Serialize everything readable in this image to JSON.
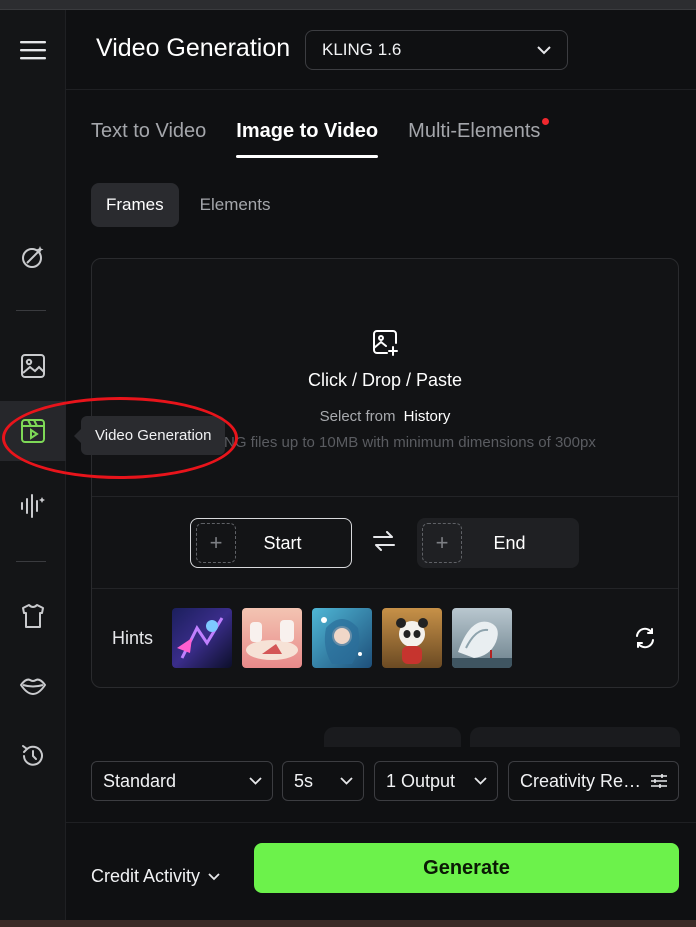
{
  "header": {
    "title": "Video Generation",
    "model": "KLING 1.6"
  },
  "tabs": [
    {
      "label": "Text to Video",
      "active": false
    },
    {
      "label": "Image to Video",
      "active": true
    },
    {
      "label": "Multi-Elements",
      "active": false,
      "has_dot": true
    }
  ],
  "subtabs": [
    {
      "label": "Frames",
      "active": true
    },
    {
      "label": "Elements",
      "active": false
    }
  ],
  "upload": {
    "title": "Click / Drop / Paste",
    "select_from": "Select from",
    "history": "History",
    "file_hint": "NG files up to 10MB with minimum dimensions of 300px"
  },
  "frames": {
    "start": "Start",
    "end": "End"
  },
  "hints": {
    "label": "Hints",
    "thumbnails": [
      "hint-thumb-1",
      "hint-thumb-2",
      "hint-thumb-3",
      "hint-thumb-4",
      "hint-thumb-5"
    ]
  },
  "tooltip": {
    "text": "Video Generation"
  },
  "settings": {
    "mode": "Standard",
    "duration": "5s",
    "outputs": "1 Output",
    "creativity": "Creativity Re…"
  },
  "footer": {
    "credit_label": "Credit Activity",
    "generate_label": "Generate"
  },
  "sidebar": {
    "items": [
      "ai-images-icon",
      "image-icon",
      "video-generation-icon",
      "audio-icon",
      "clothing-icon",
      "lip-sync-icon",
      "history-icon"
    ],
    "active": "video-generation-icon"
  },
  "colors": {
    "accent_green": "#6cf24b",
    "notification_dot": "#f0282e",
    "highlight_ring": "#e8141b",
    "active_icon": "#7ed957"
  }
}
